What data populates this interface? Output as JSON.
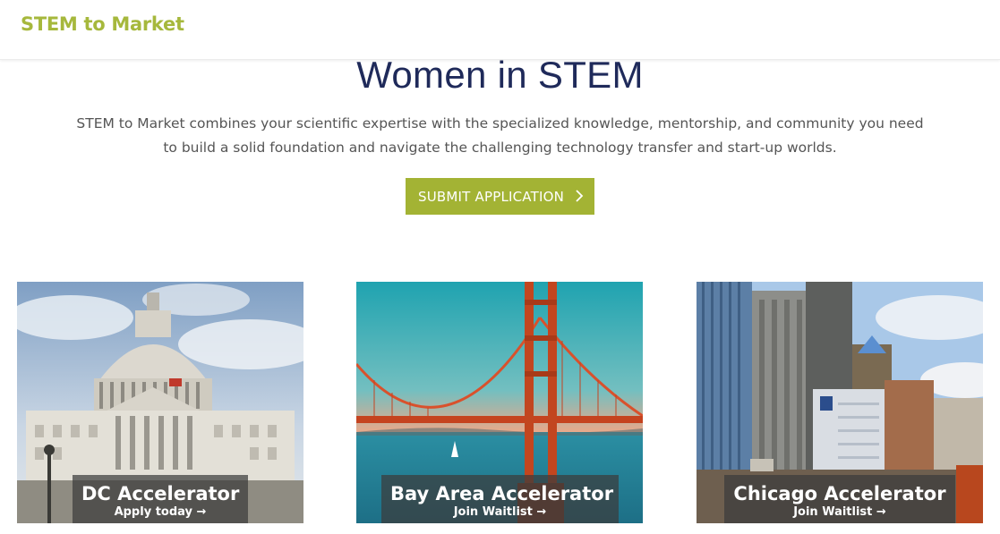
{
  "header": {
    "brand": "STEM to Market"
  },
  "hero": {
    "title": "Women in STEM",
    "description": "STEM to Market combines your scientific expertise with the specialized knowledge, mentorship, and community you need to build a solid foundation and navigate the challenging technology transfer and start-up worlds.",
    "cta_label": "SUBMIT APPLICATION"
  },
  "accelerators": [
    {
      "title": "DC Accelerator",
      "subtitle": "Apply today →"
    },
    {
      "title": "Bay Area Accelerator",
      "subtitle": "Join Waitlist →"
    },
    {
      "title": "Chicago Accelerator",
      "subtitle": "Join Waitlist →"
    }
  ],
  "colors": {
    "brand": "#a6b83c",
    "cta": "#a3b334",
    "title": "#1f2a5a"
  },
  "icons": {
    "cta": "chevron-right-icon"
  }
}
